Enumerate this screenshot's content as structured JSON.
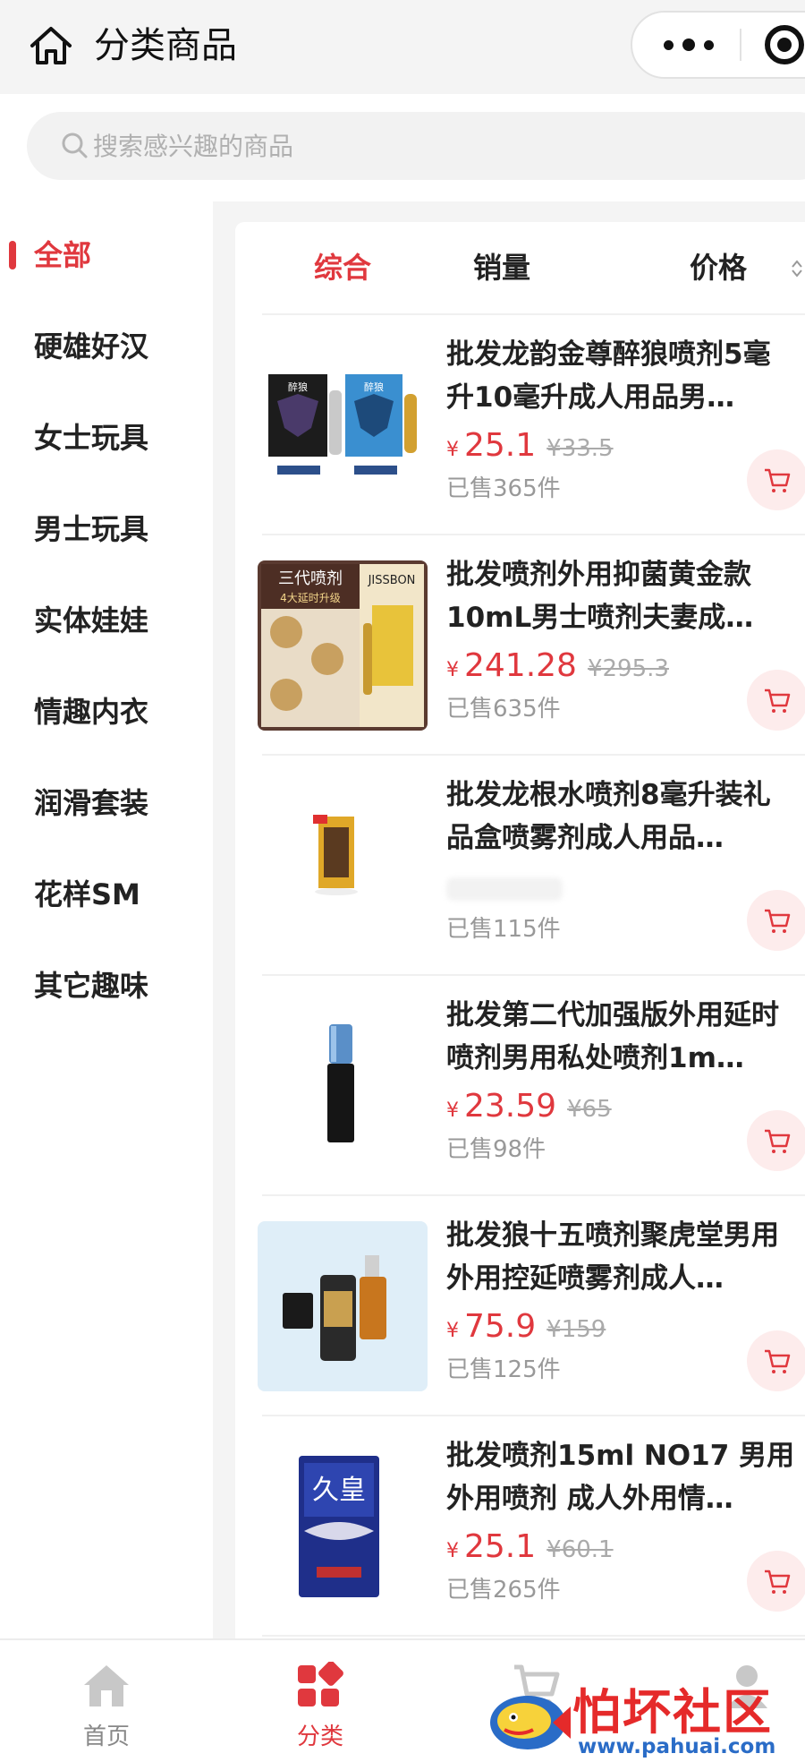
{
  "header": {
    "title": "分类商品"
  },
  "search": {
    "placeholder": "搜索感兴趣的商品"
  },
  "categories": [
    {
      "label": "全部",
      "active": true
    },
    {
      "label": "硬雄好汉"
    },
    {
      "label": "女士玩具"
    },
    {
      "label": "男士玩具"
    },
    {
      "label": "实体娃娃"
    },
    {
      "label": "情趣内衣"
    },
    {
      "label": "润滑套装"
    },
    {
      "label": "花样SM"
    },
    {
      "label": "其它趣味"
    }
  ],
  "sort": {
    "comprehensive": "综合",
    "sales": "销量",
    "price": "价格",
    "active": "comprehensive"
  },
  "currency": "¥",
  "products": [
    {
      "title": "批发龙韵金尊醉狼喷剂5毫升10毫升成人用品男…",
      "price": "25.1",
      "original_price": "¥33.5",
      "sold": "已售365件",
      "image_text": "醉狼 DRUNK WOLF"
    },
    {
      "title": "批发喷剂外用抑菌黄金款10mL男士喷剂夫妻成…",
      "price": "241.28",
      "original_price": "¥295.3",
      "sold": "已售635件",
      "image_text": "三代喷剂 4大延时升级"
    },
    {
      "title": "批发龙根水喷剂8毫升装礼品盒喷雾剂成人用品…",
      "price": "",
      "original_price": "",
      "sold": "已售115件",
      "image_text": ""
    },
    {
      "title": "批发第二代加强版外用延时喷剂男用私处喷剂1m…",
      "price": "23.59",
      "original_price": "¥65",
      "sold": "已售98件",
      "image_text": ""
    },
    {
      "title": "批发狼十五喷剂聚虎堂男用外用控延喷雾剂成人…",
      "price": "75.9",
      "original_price": "¥159",
      "sold": "已售125件",
      "image_text": ""
    },
    {
      "title": "批发喷剂15ml NO17 男用外用喷剂 成人外用情…",
      "price": "25.1",
      "original_price": "¥60.1",
      "sold": "已售265件",
      "image_text": "久皇"
    }
  ],
  "tabbar": {
    "home": "首页",
    "category": "分类",
    "cart": "",
    "profile": ""
  },
  "watermark": {
    "text": "怕坏社区",
    "url": "www.pahuai.com"
  },
  "colors": {
    "accent": "#e0383e",
    "price": "#e0383e",
    "muted": "#999999"
  }
}
